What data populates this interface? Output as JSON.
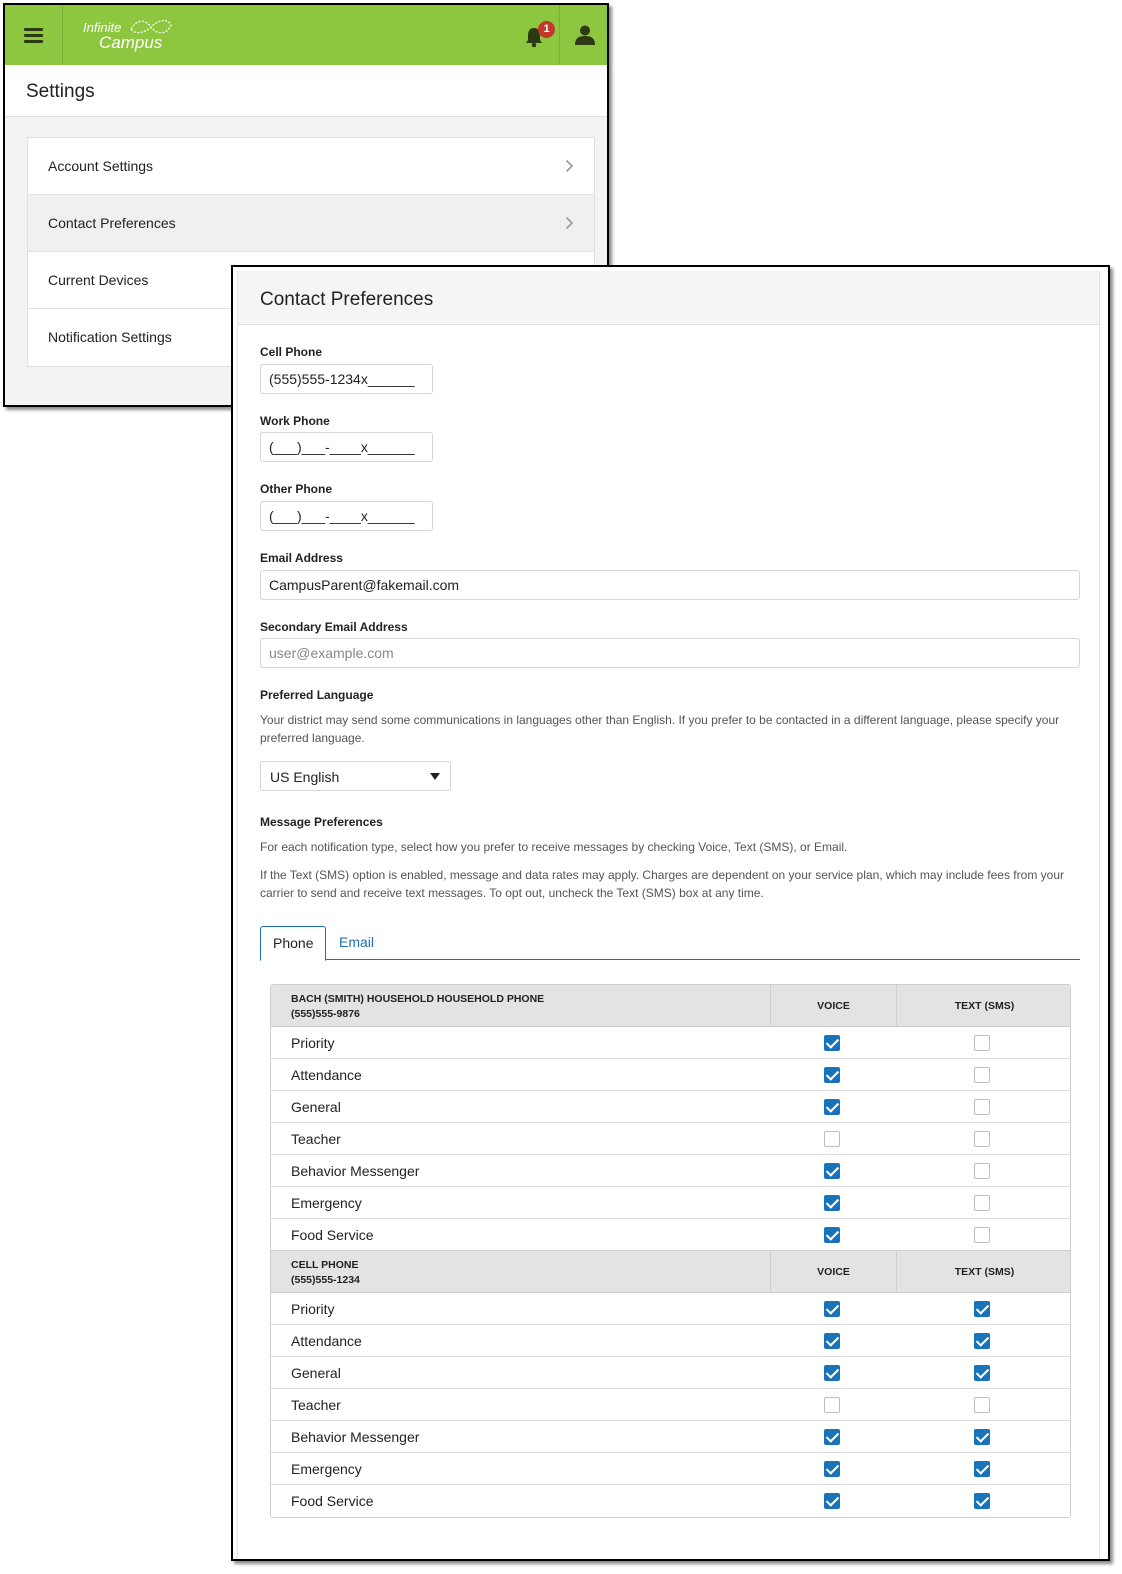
{
  "app": {
    "logo_line1": "Infinite",
    "logo_line2": "Campus",
    "notification_count": "1",
    "brand_color": "#8dc63f"
  },
  "settings": {
    "title": "Settings",
    "items": [
      {
        "label": "Account Settings",
        "chevron": true
      },
      {
        "label": "Contact Preferences",
        "chevron": true
      },
      {
        "label": "Current Devices",
        "chevron": false
      },
      {
        "label": "Notification Settings",
        "chevron": false
      }
    ]
  },
  "contact": {
    "title": "Contact Preferences",
    "cell_phone": {
      "label": "Cell Phone",
      "value": "(555)555-1234x______"
    },
    "work_phone": {
      "label": "Work Phone",
      "value": "(___)___-____x______"
    },
    "other_phone": {
      "label": "Other Phone",
      "value": "(___)___-____x______"
    },
    "email": {
      "label": "Email Address",
      "value": "CampusParent@fakemail.com"
    },
    "secondary_email": {
      "label": "Secondary Email Address",
      "placeholder": "user@example.com"
    },
    "language": {
      "label": "Preferred Language",
      "help": "Your district may send some communications in languages other than English. If you prefer to be contacted in a different language, please specify your preferred language.",
      "selected": "US English"
    },
    "message_prefs": {
      "label": "Message Preferences",
      "help1": "For each notification type, select how you prefer to receive messages by checking Voice, Text (SMS), or Email.",
      "help2": "If the Text (SMS) option is enabled, message and data rates may apply. Charges are dependent on your service plan, which may include fees from your carrier to send and receive text messages. To opt out, uncheck the Text (SMS) box at any time."
    },
    "tabs": [
      "Phone",
      "Email"
    ],
    "active_tab": "Phone",
    "accent_color": "#1a72bb",
    "groups": [
      {
        "title": "BACH (SMITH) HOUSEHOLD HOUSEHOLD PHONE",
        "number": "(555)555-9876",
        "col_voice": "VOICE",
        "col_sms": "TEXT (SMS)",
        "rows": [
          {
            "label": "Priority",
            "voice": true,
            "sms": false
          },
          {
            "label": "Attendance",
            "voice": true,
            "sms": false
          },
          {
            "label": "General",
            "voice": true,
            "sms": false
          },
          {
            "label": "Teacher",
            "voice": false,
            "sms": false
          },
          {
            "label": "Behavior Messenger",
            "voice": true,
            "sms": false
          },
          {
            "label": "Emergency",
            "voice": true,
            "sms": false
          },
          {
            "label": "Food Service",
            "voice": true,
            "sms": false
          }
        ]
      },
      {
        "title": "CELL PHONE",
        "number": "(555)555-1234",
        "col_voice": "VOICE",
        "col_sms": "TEXT (SMS)",
        "rows": [
          {
            "label": "Priority",
            "voice": true,
            "sms": true
          },
          {
            "label": "Attendance",
            "voice": true,
            "sms": true
          },
          {
            "label": "General",
            "voice": true,
            "sms": true
          },
          {
            "label": "Teacher",
            "voice": false,
            "sms": false
          },
          {
            "label": "Behavior Messenger",
            "voice": true,
            "sms": true
          },
          {
            "label": "Emergency",
            "voice": true,
            "sms": true
          },
          {
            "label": "Food Service",
            "voice": true,
            "sms": true
          }
        ]
      }
    ]
  }
}
